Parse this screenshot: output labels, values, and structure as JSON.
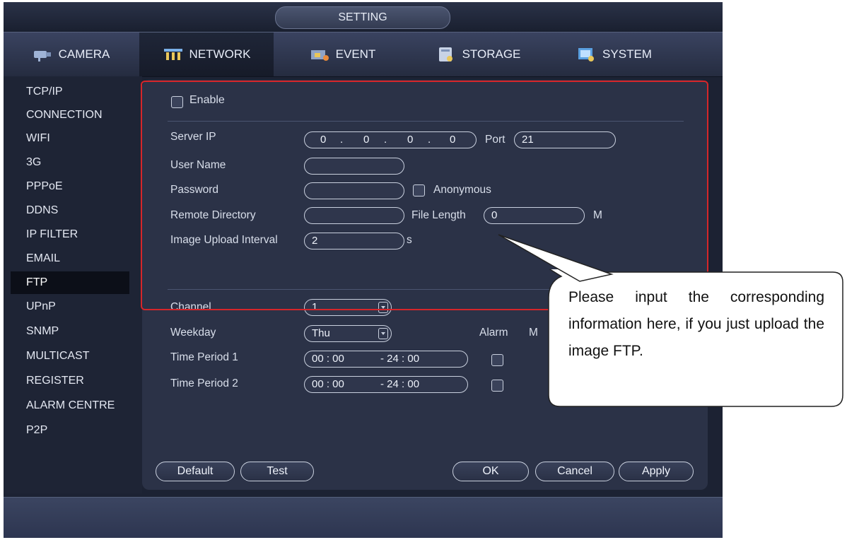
{
  "title": "SETTING",
  "tabs": [
    {
      "label": "CAMERA",
      "icon": "camera-icon"
    },
    {
      "label": "NETWORK",
      "icon": "network-icon"
    },
    {
      "label": "EVENT",
      "icon": "event-icon"
    },
    {
      "label": "STORAGE",
      "icon": "storage-icon"
    },
    {
      "label": "SYSTEM",
      "icon": "system-icon"
    }
  ],
  "sidebar": {
    "items": [
      "TCP/IP",
      "CONNECTION",
      "WIFI",
      "3G",
      "PPPoE",
      "DDNS",
      "IP FILTER",
      "EMAIL",
      "FTP",
      "UPnP",
      "SNMP",
      "MULTICAST",
      "REGISTER",
      "ALARM CENTRE",
      "P2P"
    ],
    "active": "FTP"
  },
  "form": {
    "enable_label": "Enable",
    "server_ip_label": "Server IP",
    "server_ip": [
      "0",
      "0",
      "0",
      "0"
    ],
    "ip_sep": ".",
    "port_label": "Port",
    "port_value": "21",
    "user_name_label": "User Name",
    "user_name_value": "",
    "password_label": "Password",
    "password_value": "",
    "anonymous_label": "Anonymous",
    "remote_directory_label": "Remote Directory",
    "remote_directory_value": "",
    "file_length_label": "File Length",
    "file_length_value": "0",
    "file_length_unit": "M",
    "upload_interval_label": "Image Upload Interval",
    "upload_interval_value": "2",
    "upload_interval_unit": "s",
    "channel_label": "Channel",
    "channel_value": "1",
    "weekday_label": "Weekday",
    "weekday_value": "Thu",
    "alarm_label": "Alarm",
    "md_label_partial": "M",
    "period1_label": "Time Period 1",
    "period1_start": "00 : 00",
    "period1_end": "- 24 : 00",
    "period2_label": "Time Period 2",
    "period2_start": "00 : 00",
    "period2_end": "- 24 : 00"
  },
  "buttons": {
    "default": "Default",
    "test": "Test",
    "ok": "OK",
    "cancel": "Cancel",
    "apply": "Apply"
  },
  "callout": "Please input the corresponding information here, if you just upload the image FTP.",
  "colors": {
    "highlight": "#d6262a",
    "background": "#1c2233",
    "panel": "#2b3247"
  }
}
